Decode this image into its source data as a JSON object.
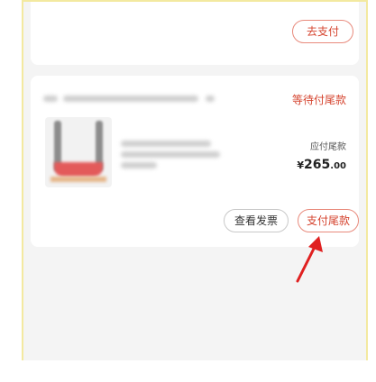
{
  "top_card": {
    "pay_button": "去支付"
  },
  "order": {
    "status": "等待付尾款",
    "price_label": "应付尾款",
    "currency": "¥",
    "price_int": "265",
    "price_dec": ".00",
    "actions": {
      "invoice": "查看发票",
      "pay_balance": "支付尾款"
    }
  },
  "colors": {
    "accent_red": "#d5432e",
    "frame_yellow": "#f3e9a0",
    "background": "#f4f4f4"
  }
}
